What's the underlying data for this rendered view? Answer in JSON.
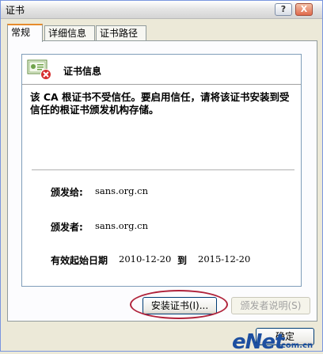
{
  "window": {
    "title": "证书",
    "help_label": "?",
    "close_label": "X"
  },
  "tabs": [
    {
      "label": "常规",
      "active": true
    },
    {
      "label": "详细信息",
      "active": false
    },
    {
      "label": "证书路径",
      "active": false
    }
  ],
  "certificate": {
    "header": "证书信息",
    "warning": "该 CA 根证书不受信任。要启用信任，请将该证书安装到受信任的根证书颁发机构存储。",
    "issued_to_label": "颁发给:",
    "issued_to_value": "sans.org.cn",
    "issued_by_label": "颁发者:",
    "issued_by_value": "sans.org.cn",
    "validity_label": "有效起始日期",
    "valid_from": "2010-12-20",
    "to_label": "到",
    "valid_to": "2015-12-20"
  },
  "buttons": {
    "install": "安装证书(I)...",
    "issuer_statement": "颁发者说明(S)",
    "ok": "确定"
  },
  "watermark": {
    "brand": "eNet",
    "sub": "com.cn"
  },
  "colors": {
    "window_bg": "#ECE9D8",
    "highlight_oval": "#B0233B",
    "tab_accent": "#E68B2C",
    "watermark": "#1D4FA0"
  }
}
